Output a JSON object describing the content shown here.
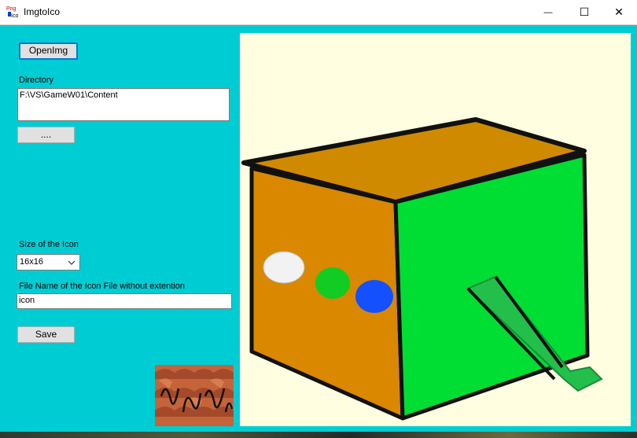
{
  "window": {
    "title": "ImgtoIco",
    "icon_text_top": "Png",
    "icon_text_bottom": "Ico",
    "minimize_glyph": "—",
    "maximize_glyph": "☐",
    "close_glyph": "✕"
  },
  "form": {
    "open_button_label": "OpenImg",
    "directory_label": "Directory",
    "directory_value": "F:\\VS\\GameW01\\Content",
    "browse_button_label": "....",
    "size_label": "Size of the Icon",
    "size_selected": "16x16",
    "filename_label": "File Name of the Icon File without extention",
    "filename_value": "icon",
    "save_button_label": "Save"
  },
  "colors": {
    "background": "#00CDD3",
    "preview_background": "#FFFEE0",
    "box_front": "#D98800",
    "box_top": "#D08A00",
    "box_side": "#00DD33",
    "dot_white": "#F2F2F2",
    "dot_green": "#11CC22",
    "dot_blue": "#1550FF"
  },
  "icons": [
    "app-icon",
    "minimize-icon",
    "maximize-icon",
    "close-icon",
    "chevron-down-icon"
  ]
}
